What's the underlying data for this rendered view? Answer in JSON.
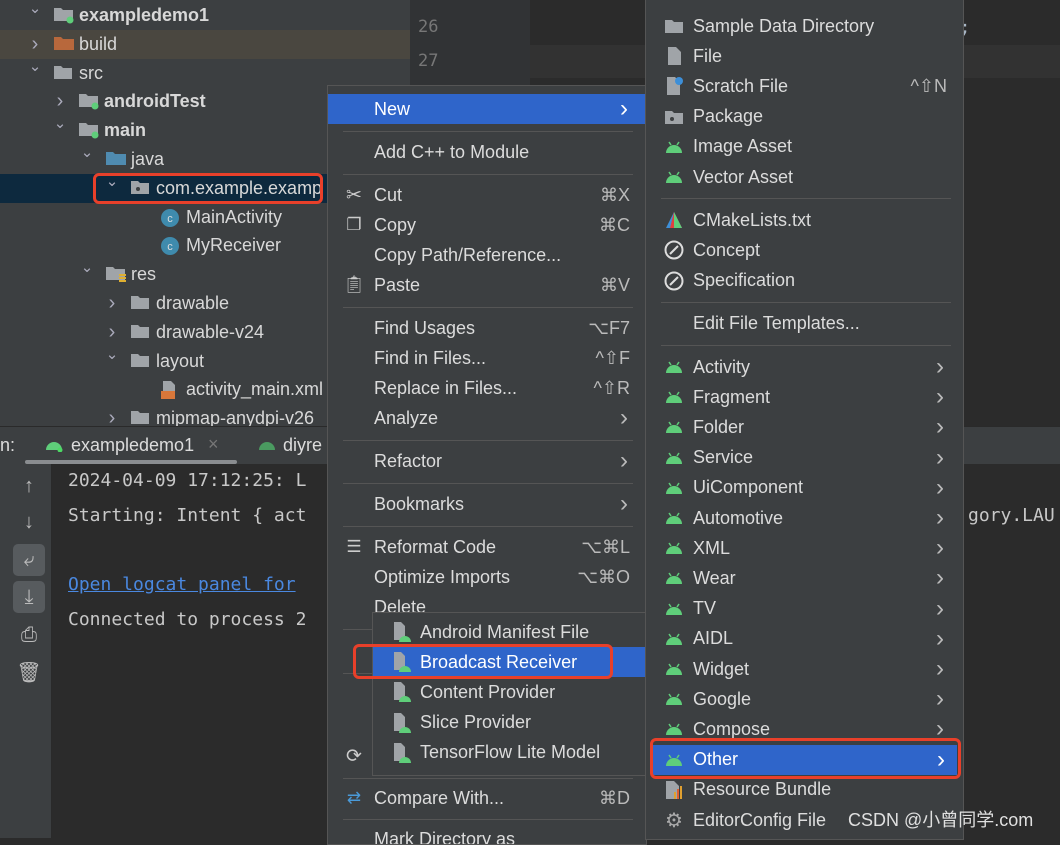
{
  "colors": {
    "accent": "#2f65ca",
    "highlight_box": "#e8402a",
    "android_green": "#5fce7a",
    "link": "#4a88e0"
  },
  "project_tree": [
    {
      "label": "exampledemo1",
      "depth": 0,
      "expanded": true,
      "icon": "module-folder-icon",
      "bold": true
    },
    {
      "label": "build",
      "depth": 1,
      "expanded": false,
      "icon": "build-folder-icon",
      "excluded": true
    },
    {
      "label": "src",
      "depth": 1,
      "expanded": true,
      "icon": "folder-icon"
    },
    {
      "label": "androidTest",
      "depth": 2,
      "expanded": false,
      "icon": "source-set-folder-icon",
      "bold": true
    },
    {
      "label": "main",
      "depth": 2,
      "expanded": true,
      "icon": "source-set-folder-icon",
      "bold": true
    },
    {
      "label": "java",
      "depth": 3,
      "expanded": true,
      "icon": "source-root-folder-icon"
    },
    {
      "label": "com.example.examp",
      "depth": 4,
      "expanded": true,
      "icon": "package-icon",
      "selected": true
    },
    {
      "label": "MainActivity",
      "depth": 5,
      "icon": "class-icon"
    },
    {
      "label": "MyReceiver",
      "depth": 5,
      "icon": "class-icon"
    },
    {
      "label": "res",
      "depth": 3,
      "expanded": true,
      "icon": "resources-folder-icon"
    },
    {
      "label": "drawable",
      "depth": 4,
      "expanded": false,
      "icon": "folder-icon"
    },
    {
      "label": "drawable-v24",
      "depth": 4,
      "expanded": false,
      "icon": "folder-icon"
    },
    {
      "label": "layout",
      "depth": 4,
      "expanded": true,
      "icon": "folder-icon"
    },
    {
      "label": "activity_main.xml",
      "depth": 5,
      "icon": "xml-file-icon"
    },
    {
      "label": "mipmap-anydpi-v26",
      "depth": 4,
      "expanded": false,
      "icon": "folder-icon"
    }
  ],
  "editor": {
    "line_numbers": [
      "26",
      "27"
    ],
    "code_fragment": "t);"
  },
  "run_panel": {
    "label": "n:",
    "tabs": [
      {
        "label": "exampledemo1",
        "active": true
      },
      {
        "label": "diyre",
        "active": false
      }
    ],
    "console": [
      {
        "text": "2024-04-09 17:12:25: L"
      },
      {
        "text": "Starting: Intent { act",
        "tail": "gory.LAU"
      },
      {
        "text": "Open logcat panel for",
        "link": true
      },
      {
        "text": "Connected to process 2"
      }
    ],
    "tools": [
      "arrow-up-icon",
      "arrow-down-icon",
      "soft-wrap-icon",
      "scroll-to-end-icon",
      "print-icon",
      "trash-icon"
    ]
  },
  "context_menu": {
    "items": [
      {
        "label": "New",
        "submenu": true,
        "highlighted": true
      },
      {
        "label": "Add C++ to Module"
      },
      {
        "label": "Cut",
        "shortcut": "⌘X",
        "icon": "scissors-icon"
      },
      {
        "label": "Copy",
        "shortcut": "⌘C",
        "icon": "copy-icon"
      },
      {
        "label": "Copy Path/Reference..."
      },
      {
        "label": "Paste",
        "shortcut": "⌘V",
        "icon": "paste-icon"
      },
      {
        "label": "Find Usages",
        "shortcut": "⌥F7"
      },
      {
        "label": "Find in Files...",
        "shortcut": "^⇧F"
      },
      {
        "label": "Replace in Files...",
        "shortcut": "^⇧R"
      },
      {
        "label": "Analyze",
        "submenu": true
      },
      {
        "label": "Refactor",
        "submenu": true
      },
      {
        "label": "Bookmarks",
        "submenu": true
      },
      {
        "label": "Reformat Code",
        "shortcut": "⌥⌘L",
        "icon": "reformat-icon"
      },
      {
        "label": "Optimize Imports",
        "shortcut": "⌥⌘O"
      },
      {
        "label": "Delete"
      },
      {
        "label": "",
        "icon": "sync-icon"
      },
      {
        "label": "Compare With...",
        "shortcut": "⌘D",
        "icon": "compare-icon"
      },
      {
        "label": "Mark Directory as"
      }
    ]
  },
  "new_submenu": {
    "items": [
      {
        "label": "Sample Data Directory",
        "icon": "folder-icon"
      },
      {
        "label": "File",
        "icon": "file-icon"
      },
      {
        "label": "Scratch File",
        "icon": "scratch-file-icon",
        "shortcut": "^⇧N"
      },
      {
        "label": "Package",
        "icon": "package-icon"
      },
      {
        "label": "Image Asset",
        "icon": "android-icon"
      },
      {
        "label": "Vector Asset",
        "icon": "android-icon",
        "sep_after": true
      },
      {
        "label": "CMakeLists.txt",
        "icon": "cmake-icon"
      },
      {
        "label": "Concept",
        "icon": "concept-icon"
      },
      {
        "label": "Specification",
        "icon": "concept-icon",
        "sep_after": true
      },
      {
        "label": "Edit File Templates...",
        "sep_after": true
      },
      {
        "label": "Activity",
        "icon": "android-icon",
        "submenu": true
      },
      {
        "label": "Fragment",
        "icon": "android-icon",
        "submenu": true
      },
      {
        "label": "Folder",
        "icon": "android-icon",
        "submenu": true
      },
      {
        "label": "Service",
        "icon": "android-icon",
        "submenu": true
      },
      {
        "label": "UiComponent",
        "icon": "android-icon",
        "submenu": true
      },
      {
        "label": "Automotive",
        "icon": "android-icon",
        "submenu": true
      },
      {
        "label": "XML",
        "icon": "android-icon",
        "submenu": true
      },
      {
        "label": "Wear",
        "icon": "android-icon",
        "submenu": true
      },
      {
        "label": "TV",
        "icon": "android-icon",
        "submenu": true
      },
      {
        "label": "AIDL",
        "icon": "android-icon",
        "submenu": true
      },
      {
        "label": "Widget",
        "icon": "android-icon",
        "submenu": true
      },
      {
        "label": "Google",
        "icon": "android-icon",
        "submenu": true
      },
      {
        "label": "Compose",
        "icon": "android-icon",
        "submenu": true
      },
      {
        "label": "Other",
        "icon": "android-icon",
        "submenu": true,
        "highlighted": true
      },
      {
        "label": "Resource Bundle",
        "icon": "resource-bundle-icon"
      },
      {
        "label": "EditorConfig File",
        "icon": "gear-icon"
      }
    ]
  },
  "other_submenu": {
    "items": [
      {
        "label": "Android Manifest File",
        "icon": "android-file-icon"
      },
      {
        "label": "Broadcast Receiver",
        "icon": "android-file-icon",
        "highlighted": true
      },
      {
        "label": "Content Provider",
        "icon": "android-file-icon"
      },
      {
        "label": "Slice Provider",
        "icon": "android-file-icon"
      },
      {
        "label": "TensorFlow Lite Model",
        "icon": "android-file-icon"
      }
    ]
  },
  "watermark": "CSDN @小曾同学.com"
}
